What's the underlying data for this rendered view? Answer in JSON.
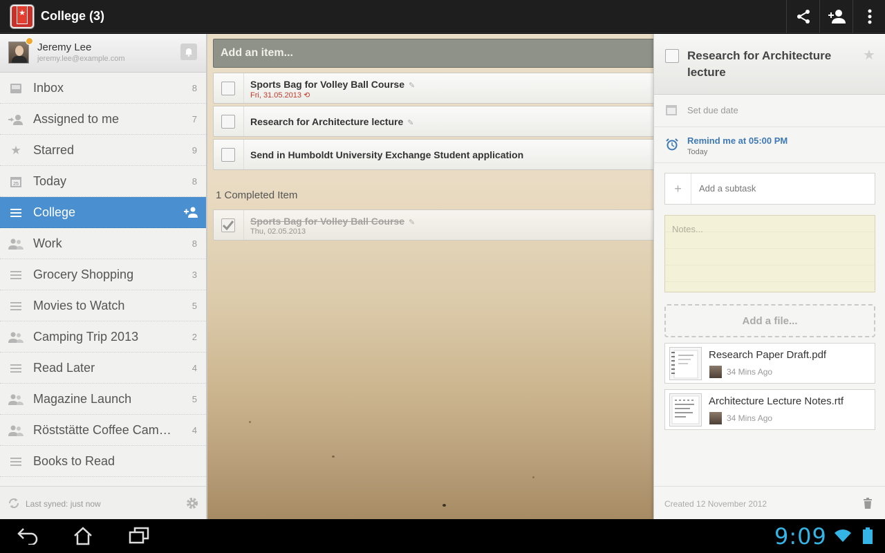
{
  "header": {
    "title": "College (3)",
    "icons": [
      "share-icon",
      "add-person-icon",
      "overflow-menu-icon"
    ]
  },
  "user": {
    "name": "Jeremy Lee",
    "email": "jeremy.lee@example.com"
  },
  "sidebar": {
    "items": [
      {
        "label": "Inbox",
        "count": "8",
        "icon": "inbox-icon"
      },
      {
        "label": "Assigned to me",
        "count": "7",
        "icon": "assigned-icon"
      },
      {
        "label": "Starred",
        "count": "9",
        "icon": "star-icon"
      },
      {
        "label": "Today",
        "count": "8",
        "icon": "calendar-icon"
      },
      {
        "label": "College",
        "count": "",
        "icon": "list-icon"
      },
      {
        "label": "Work",
        "count": "8",
        "icon": "shared-icon"
      },
      {
        "label": "Grocery Shopping",
        "count": "3",
        "icon": "list-icon"
      },
      {
        "label": "Movies to Watch",
        "count": "5",
        "icon": "list-icon"
      },
      {
        "label": "Camping Trip 2013",
        "count": "2",
        "icon": "shared-icon"
      },
      {
        "label": "Read Later",
        "count": "4",
        "icon": "list-icon"
      },
      {
        "label": "Magazine Launch",
        "count": "5",
        "icon": "shared-icon"
      },
      {
        "label": "Röststätte Coffee Cam…",
        "count": "4",
        "icon": "shared-icon"
      },
      {
        "label": "Books to Read",
        "count": "",
        "icon": "list-icon"
      }
    ],
    "sync_text": "Last syned: just now"
  },
  "main": {
    "add_placeholder": "Add an item...",
    "tasks": [
      {
        "title": "Sports Bag for Volley Ball Course",
        "due": "Fri, 31.05.2013"
      },
      {
        "title": "Research for Architecture lecture",
        "due": ""
      },
      {
        "title": "Send in Humboldt University Exchange Student application",
        "due": ""
      }
    ],
    "completed_heading": "1 Completed Item",
    "completed": [
      {
        "title": "Sports Bag for Volley Ball Course",
        "due": "Thu, 02.05.2013"
      }
    ]
  },
  "detail": {
    "title": "Research for Architecture lecture",
    "due_label": "Set due date",
    "reminder": "Remind me at 05:00 PM",
    "reminder_sub": "Today",
    "subtask_placeholder": "Add a subtask",
    "notes_placeholder": "Notes...",
    "add_file": "Add a file...",
    "files": [
      {
        "name": "Research Paper Draft.pdf",
        "time": "34 Mins Ago"
      },
      {
        "name": "Architecture Lecture Notes.rtf",
        "time": "34 Mins Ago"
      }
    ],
    "created": "Created 12 November 2012"
  },
  "system": {
    "clock": "9:09"
  },
  "colors": {
    "accent": "#4a8fcf",
    "due_red": "#c0392b",
    "clock": "#34b5e5",
    "reminder": "#3e79b5"
  }
}
